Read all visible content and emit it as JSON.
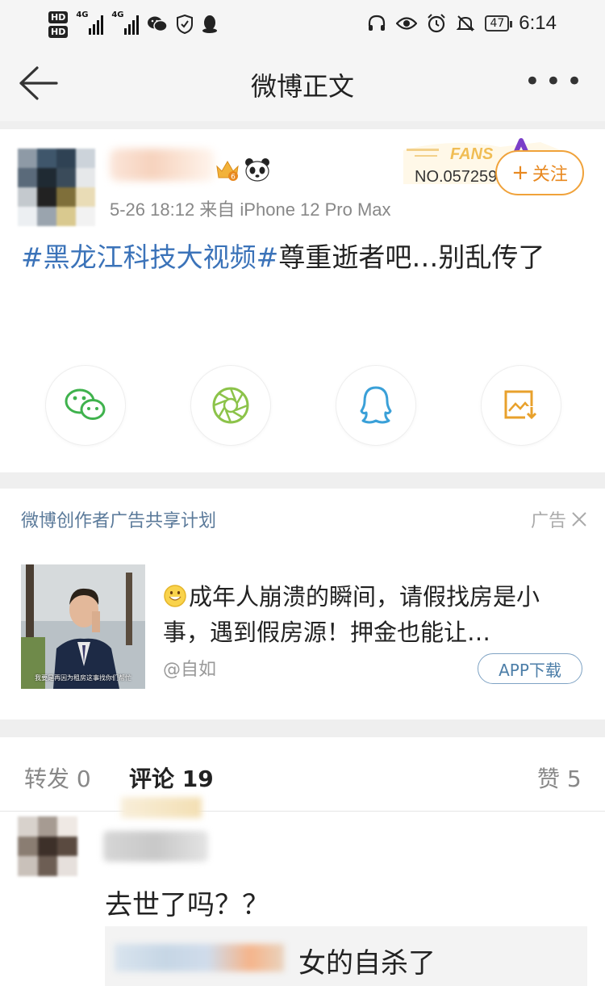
{
  "status_bar": {
    "network_labels": [
      "HD",
      "HD"
    ],
    "signal1_label": "4G",
    "signal2_label": "4G",
    "battery_level": "47",
    "time": "6:14",
    "icons": [
      "hd-icon",
      "signal-icon",
      "wechat-icon",
      "shield-icon",
      "qq-icon",
      "headset-icon",
      "eye-icon",
      "alarm-icon",
      "mute-icon",
      "battery-icon"
    ]
  },
  "nav": {
    "title": "微博正文",
    "back_icon": "back-arrow-icon",
    "more_label": "•••"
  },
  "post": {
    "meta": "5-26 18:12  来自 iPhone 12 Pro Max",
    "fans_label": "FANS",
    "fans_number": "NO.057259",
    "follow_plus": "+",
    "follow_label": "关注",
    "text_tag": "#黑龙江科技大视频#",
    "text_body": "尊重逝者吧…别乱传了",
    "share_icons": [
      "wechat-icon",
      "moments-icon",
      "qq-icon",
      "save-image-icon"
    ],
    "colors": {
      "tag": "#3b73b9",
      "follow": "#e8881f"
    }
  },
  "ad": {
    "header": "微博创作者广告共享计划",
    "ad_label": "广告",
    "close_icon": "close-icon",
    "thumb_caption": "我要是再因为租房这事找你们帮忙",
    "text": "成年人崩溃的瞬间，请假找房是小事，遇到假房源！押金也能让…",
    "source": "@自如",
    "button": "APP下载"
  },
  "comments": {
    "tabs": [
      {
        "label": "转发",
        "count": "0"
      },
      {
        "label": "评论",
        "count": "19"
      },
      {
        "label": "赞",
        "count": "5"
      }
    ],
    "comment_text": "去世了吗？？",
    "reply_text": "女的自杀了"
  }
}
